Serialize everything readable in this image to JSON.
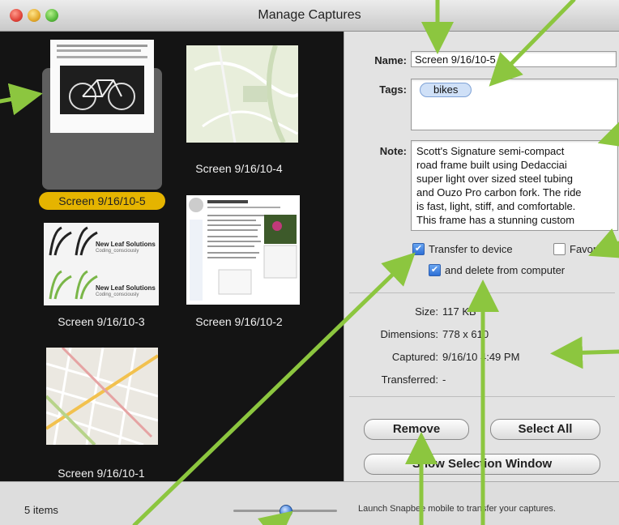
{
  "window": {
    "title": "Manage Captures"
  },
  "captures": [
    {
      "label": "Screen 9/16/10-5",
      "selected": true
    },
    {
      "label": "Screen 9/16/10-4",
      "selected": false
    },
    {
      "label": "Screen 9/16/10-3",
      "selected": false
    },
    {
      "label": "Screen 9/16/10-2",
      "selected": false
    },
    {
      "label": "Screen 9/16/10-1",
      "selected": false
    }
  ],
  "thumb_text": {
    "newleaf_title": "New Leaf Solutions",
    "newleaf_tag": "Coding_consciously"
  },
  "details": {
    "name_label": "Name:",
    "name_value": "Screen 9/16/10-5",
    "tags_label": "Tags:",
    "tags": [
      "bikes"
    ],
    "note_label": "Note:",
    "note_value": "Scott's Signature semi-compact\nroad frame built using Dedacciai\nsuper light over sized steel tubing\nand Ouzo Pro carbon fork. The ride\nis fast, light, stiff, and comfortable.\nThis frame has a stunning custom",
    "transfer_label": "Transfer to device",
    "transfer_checked": true,
    "favorite_label": "Favorite",
    "favorite_checked": false,
    "delete_label": "and delete from computer",
    "delete_checked": true
  },
  "info": {
    "size_label": "Size:",
    "size_value": "117 KB",
    "dimensions_label": "Dimensions:",
    "dimensions_value": "778 x 610",
    "captured_label": "Captured:",
    "captured_value": "9/16/10 4:49 PM",
    "transferred_label": "Transferred:",
    "transferred_value": "-"
  },
  "buttons": {
    "remove": "Remove",
    "select_all": "Select All",
    "show_selection": "Show Selection Window"
  },
  "status": {
    "count": "5 items",
    "message": "Launch Snapbee mobile to transfer your captures.",
    "zoom_fraction": 0.5
  },
  "colors": {
    "annotation_arrow": "#8cc63f",
    "selection_pill": "#e5b400",
    "pane_dark": "#141414"
  }
}
